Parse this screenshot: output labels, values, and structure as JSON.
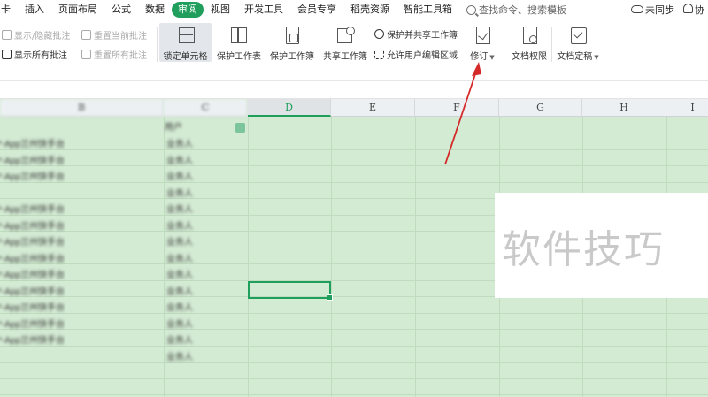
{
  "menu": {
    "tabs": [
      "卡",
      "插入",
      "页面布局",
      "公式",
      "数据",
      "审阅",
      "视图",
      "开发工具",
      "会员专享",
      "稻壳资源",
      "智能工具箱"
    ],
    "active_tab": "审阅",
    "search_placeholder": "查找命令、搜索模板",
    "sync_label": "未同步",
    "collab_label": "协"
  },
  "ribbon": {
    "show_hide_comment": "显示/隐藏批注",
    "reset_current_comment": "重置当前批注",
    "show_all_comments": "显示所有批注",
    "reset_all_comments": "重置所有批注",
    "lock_cell": "锁定单元格",
    "protect_sheet": "保护工作表",
    "protect_workbook": "保护工作簿",
    "share_workbook": "共享工作簿",
    "protect_share_workbook": "保护并共享工作簿",
    "allow_edit_range": "允许用户编辑区域",
    "revise": "修订",
    "doc_permission": "文档权限",
    "doc_final": "文档定稿"
  },
  "sheet": {
    "columns": [
      "B",
      "C",
      "D",
      "E",
      "F",
      "G",
      "H",
      "I"
    ],
    "selected_column": "D",
    "col_b_values": [
      "*-App兰州快手台",
      "*-App兰州快手台",
      "*-App兰州快手台",
      "",
      "*-App兰州快手台",
      "*-App兰州快手台",
      "*-App兰州快手台",
      "*-App兰州快手台",
      "*-App兰州快手台",
      "*-App兰州快手台",
      "*-App兰州快手台",
      "*-App兰州快手台",
      "*-App兰州快手台"
    ],
    "col_c_header": "用户",
    "col_c_values": [
      "业务人",
      "业务人",
      "业务人",
      "业务人",
      "业务人",
      "业务人",
      "业务人",
      "业务人",
      "业务人",
      "业务人",
      "业务人",
      "业务人",
      "业务人",
      "业务人"
    ]
  },
  "watermark": "软件技巧"
}
